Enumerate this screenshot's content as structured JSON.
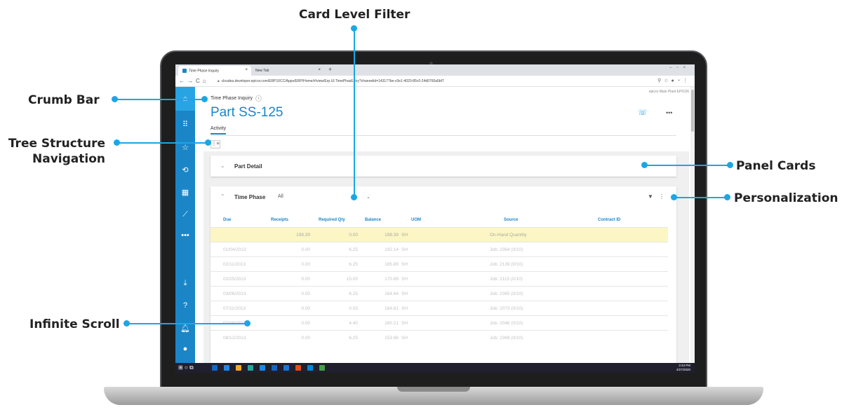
{
  "callouts": {
    "card_level_filter": "Card Level Filter",
    "crumb_bar": "Crumb Bar",
    "tree_structure_navigation": "Tree Structure Navigation",
    "panel_cards": "Panel Cards",
    "personalization": "Personalization",
    "infinite_scroll": "Infinite Scroll",
    "accent_color": "#1aa7e6"
  },
  "browser": {
    "active_tab": "Time Phase Inquiry",
    "inactive_tab": "New Tab",
    "new_tab_symbol": "+",
    "url": "cloudea.developer.epicor.com/ERP10CC/Apps/ERP/Home/#/view/Erp.UI.TimePhasEntry?channelid=143177be-c0e1-4020-85c0-24d0760a5bf7",
    "user_info": "epicor  Main Plant  EPIC06"
  },
  "app": {
    "brand_color": "#1a86c8",
    "breadcrumb": "Time Phase Inquiry",
    "page_title": "Part SS-125",
    "activity_tab": "Activity",
    "sidebar_icons": [
      "home-icon",
      "apps-icon",
      "star-icon",
      "history-icon",
      "dashboard-icon",
      "chart-icon",
      "more-icon",
      "download-icon",
      "help-icon",
      "bell-icon",
      "user-icon"
    ],
    "part_detail_card": {
      "title": "Part Detail"
    },
    "time_phase_card": {
      "title": "Time Phase",
      "filter_value": "All",
      "columns": [
        "Due",
        "Receipts",
        "Required Qty",
        "Balance",
        "UOM",
        "Source",
        "Contract ID"
      ],
      "rows": [
        {
          "due": "",
          "receipts": "198.39",
          "required": "0.00",
          "balance": "198.39",
          "uom": "SH",
          "source": "On-Hand Quantity",
          "contract": ""
        },
        {
          "due": "01/04/2013",
          "receipts": "0.00",
          "required": "6.25",
          "balance": "192.14",
          "uom": "SH",
          "source": "Job: 2364 (0/10)",
          "contract": ""
        },
        {
          "due": "02/11/2013",
          "receipts": "0.00",
          "required": "6.25",
          "balance": "185.89",
          "uom": "SH",
          "source": "Job: 2139 (0/10)",
          "contract": ""
        },
        {
          "due": "02/25/2013",
          "receipts": "0.00",
          "required": "15.00",
          "balance": "170.89",
          "uom": "SH",
          "source": "Job: 2115 (0/10)",
          "contract": ""
        },
        {
          "due": "03/06/2013",
          "receipts": "0.00",
          "required": "6.25",
          "balance": "164.64",
          "uom": "SH",
          "source": "Job: 2365 (0/10)",
          "contract": ""
        },
        {
          "due": "07/11/2013",
          "receipts": "0.00",
          "required": "0.03",
          "balance": "164.61",
          "uom": "SH",
          "source": "Job: 2073 (0/10)",
          "contract": ""
        },
        {
          "due": "07/29/2013",
          "receipts": "0.00",
          "required": "4.40",
          "balance": "160.21",
          "uom": "SH",
          "source": "Job: 2046 (0/10)",
          "contract": ""
        },
        {
          "due": "08/12/2013",
          "receipts": "0.00",
          "required": "6.25",
          "balance": "153.96",
          "uom": "SH",
          "source": "Job: 2369 (0/10)",
          "contract": ""
        }
      ]
    }
  },
  "taskbar": {
    "time": "3:43 PM",
    "date": "4/27/2020",
    "app_colors": [
      "#1565c0",
      "#1e88e5",
      "#f9a825",
      "#26a69a",
      "#1e88e5",
      "#1565c0",
      "#1976d2",
      "#e64a19",
      "#0288d1",
      "#43a047"
    ]
  }
}
